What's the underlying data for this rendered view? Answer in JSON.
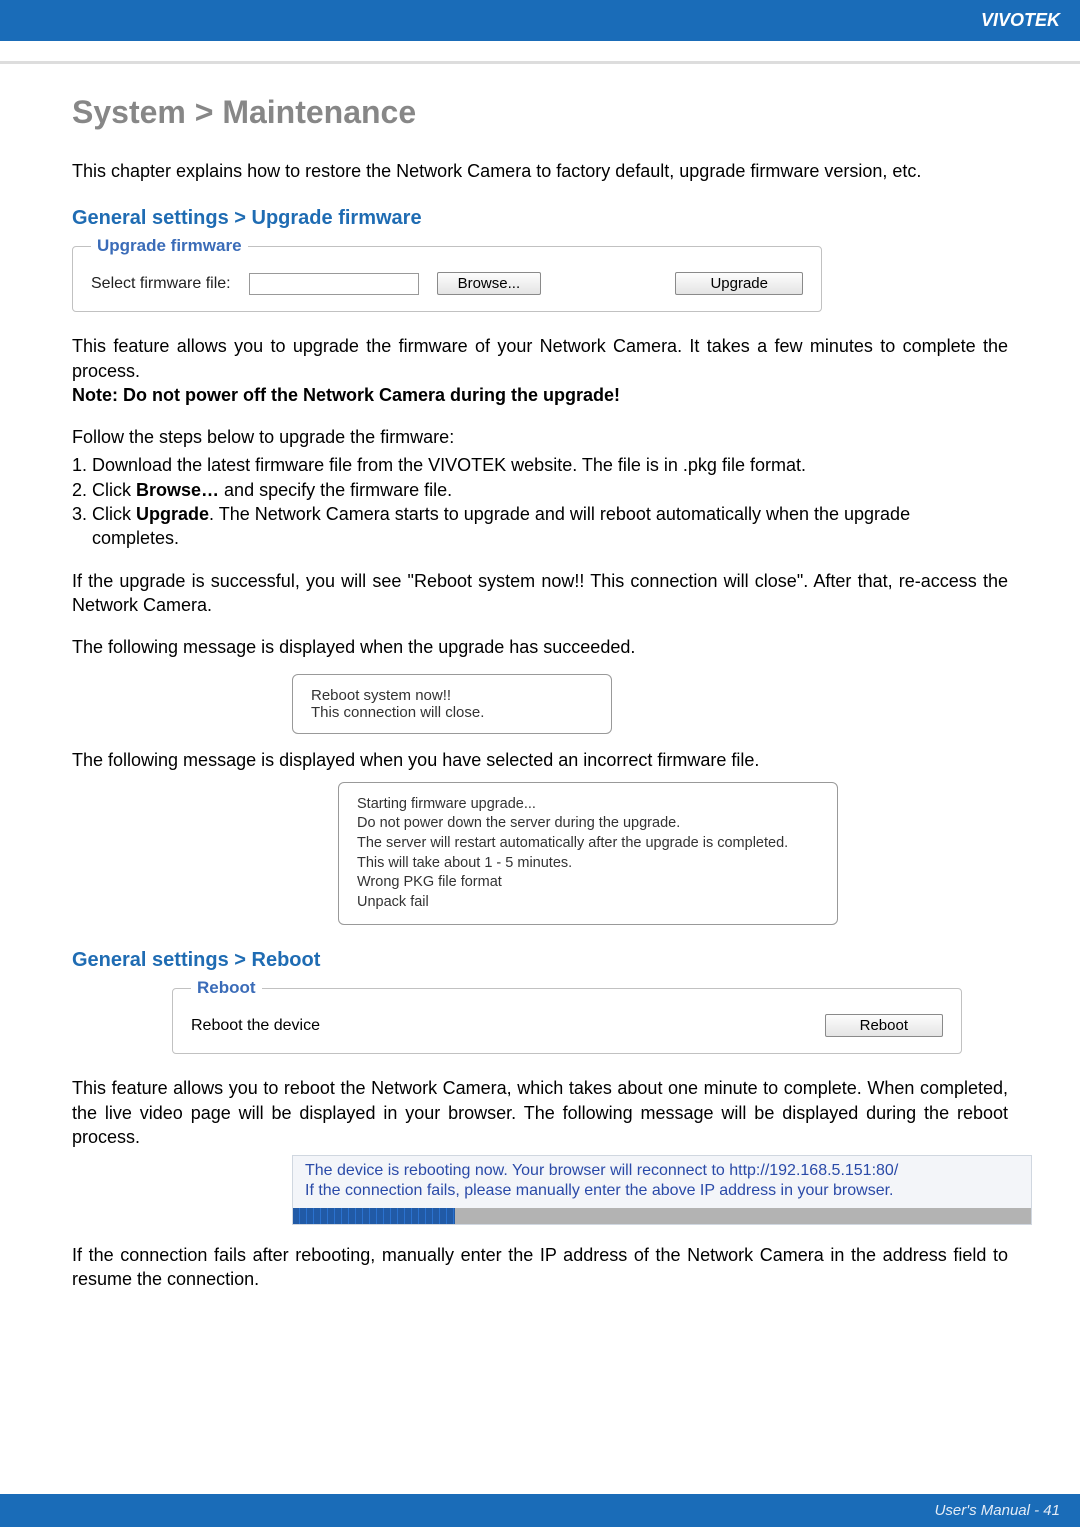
{
  "brand": "VIVOTEK",
  "page_title": "System > Maintenance",
  "intro": "This chapter explains how to restore the Network Camera to factory default, upgrade firmware version, etc.",
  "upgrade": {
    "section_heading": "General settings > Upgrade firmware",
    "legend": "Upgrade firmware",
    "label": "Select firmware file:",
    "browse_btn": "Browse...",
    "upgrade_btn": "Upgrade",
    "desc": "This feature allows you to upgrade the firmware of your Network Camera. It takes a few minutes to complete the process.",
    "note": "Note: Do not power off the Network Camera during the upgrade!",
    "steps_intro": "Follow the steps below to upgrade the firmware:",
    "step1": "1. Download the latest firmware file from the VIVOTEK website. The file is in .pkg file format.",
    "step2a": "2. Click ",
    "step2b": "Browse…",
    "step2c": " and specify the firmware file.",
    "step3a": "3. Click ",
    "step3b": "Upgrade",
    "step3c": ". The Network Camera starts to upgrade and will reboot automatically when the upgrade",
    "step3d": "completes.",
    "success_note": "If the upgrade is successful, you will see \"Reboot system now!! This connection will close\". After that, re-access the Network Camera.",
    "succeeded_intro": "The following message is displayed when the upgrade has succeeded.",
    "msg1_l1": "Reboot system now!!",
    "msg1_l2": "This connection will close.",
    "incorrect_intro": "The following message is displayed when you have selected an incorrect firmware file.",
    "msg2_l1": "Starting firmware upgrade...",
    "msg2_l2": "Do not power down the server during the upgrade.",
    "msg2_l3": "The server will restart automatically after the upgrade is completed.",
    "msg2_l4": "This will take about 1 - 5 minutes.",
    "msg2_l5": "Wrong PKG file format",
    "msg2_l6": "Unpack fail"
  },
  "reboot": {
    "section_heading": "General settings > Reboot",
    "legend": "Reboot",
    "label": "Reboot the device",
    "btn": "Reboot",
    "desc": "This feature allows you to reboot the Network Camera, which takes about one minute to complete. When completed, the live video page will be displayed in your browser. The following message will be displayed during the reboot process.",
    "info_l1": "The device is rebooting now. Your browser will reconnect to http://192.168.5.151:80/",
    "info_l2": "If the connection fails, please manually enter the above IP address in your browser.",
    "after": "If the connection fails after rebooting, manually enter the IP address of the Network Camera in the address field to resume the connection."
  },
  "footer": "User's Manual - 41"
}
